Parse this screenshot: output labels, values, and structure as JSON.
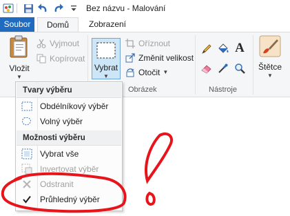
{
  "window": {
    "title": "Bez názvu - Malování"
  },
  "tabs": [
    {
      "label": "Soubor"
    },
    {
      "label": "Domů"
    },
    {
      "label": "Zobrazení"
    }
  ],
  "clipboard": {
    "paste_label": "Vložit",
    "cut_label": "Vyjmout",
    "copy_label": "Kopírovat"
  },
  "image_group": {
    "select_label": "Vybrat",
    "crop_label": "Oříznout",
    "resize_label": "Změnit velikost",
    "rotate_label": "Otočit",
    "group_label": "Obrázek"
  },
  "tools_group": {
    "group_label": "Nástroje"
  },
  "brushes": {
    "label": "Štětce"
  },
  "select_menu": {
    "shapes_header": "Tvary výběru",
    "options_header": "Možnosti výběru",
    "items": [
      {
        "label": "Obdélníkový výběr",
        "enabled": true
      },
      {
        "label": "Volný výběr",
        "enabled": true
      },
      {
        "label": "Vybrat vše",
        "enabled": true
      },
      {
        "label": "Invertovat výběr",
        "enabled": false
      },
      {
        "label": "Odstranit",
        "enabled": false
      },
      {
        "label": "Průhledný výběr",
        "enabled": true,
        "checked": true
      }
    ]
  },
  "colors": {
    "accent": "#1f6bbf",
    "annotation_red": "#e8141b",
    "selected_button_bg": "#cde6f7"
  }
}
